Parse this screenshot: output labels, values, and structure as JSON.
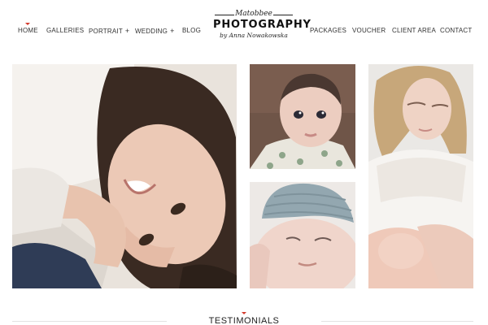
{
  "nav": {
    "left": [
      {
        "label": "HOME",
        "active": true
      },
      {
        "label": "GALLERIES"
      },
      {
        "label": "PORTRAIT",
        "dropdown": "+"
      },
      {
        "label": "WEDDING",
        "dropdown": "+"
      },
      {
        "label": "BLOG"
      }
    ],
    "right": [
      {
        "label": "PACKAGES"
      },
      {
        "label": "VOUCHER"
      },
      {
        "label": "CLIENT AREA"
      },
      {
        "label": "CONTACT"
      }
    ]
  },
  "logo": {
    "line1": "Matobbee",
    "line2": "PHOTOGRAPHY",
    "line3": "by Anna Nowakowska"
  },
  "gallery": {
    "photos": [
      {
        "subject": "girl-lying-smiling"
      },
      {
        "subject": "baby-portrait"
      },
      {
        "subject": "newborn-knit-hat"
      },
      {
        "subject": "mother-holding-newborn"
      }
    ]
  },
  "section": {
    "title": "TESTIMONIALS"
  },
  "colors": {
    "accent": "#d33a2c",
    "text": "#333333",
    "background": "#ffffff"
  }
}
